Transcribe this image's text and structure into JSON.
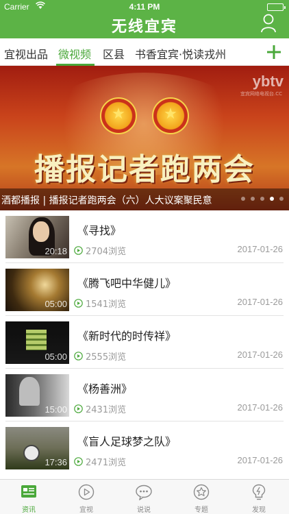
{
  "status_bar": {
    "carrier": "Carrier",
    "time": "4:11 PM"
  },
  "header": {
    "title": "无线宜宾",
    "user_icon": "user-icon"
  },
  "category_tabs": [
    {
      "label": "宜视出品",
      "active": false
    },
    {
      "label": "微视频",
      "active": true
    },
    {
      "label": "区县",
      "active": false
    },
    {
      "label": "书香宜宾·悦读戎州",
      "active": false
    }
  ],
  "add_tab_icon": "plus-icon",
  "banner": {
    "headline": "播报记者跑两会",
    "watermark": "ybtv",
    "watermark_sub": "宜宾网络电视台.CC",
    "caption": "酒都播报 | 播报记者跑两会（六）人大议案聚民意",
    "dots_total": 5,
    "dots_active_index": 3
  },
  "videos": [
    {
      "title": "《寻找》",
      "duration": "20:18",
      "views": "2704浏览",
      "date": "2017-01-26"
    },
    {
      "title": "《腾飞吧中华健儿》",
      "duration": "05:00",
      "views": "1541浏览",
      "date": "2017-01-26"
    },
    {
      "title": "《新时代的时传祥》",
      "duration": "05:00",
      "views": "2555浏览",
      "date": "2017-01-26"
    },
    {
      "title": "《杨善洲》",
      "duration": "15:00",
      "views": "2431浏览",
      "date": "2017-01-26"
    },
    {
      "title": "《盲人足球梦之队》",
      "duration": "17:36",
      "views": "2471浏览",
      "date": "2017-01-26"
    }
  ],
  "bottom_tabs": [
    {
      "label": "资讯",
      "icon": "news-icon",
      "active": true
    },
    {
      "label": "宜视",
      "icon": "play-circle-icon",
      "active": false
    },
    {
      "label": "说说",
      "icon": "chat-bubble-icon",
      "active": false
    },
    {
      "label": "专题",
      "icon": "star-icon",
      "active": false
    },
    {
      "label": "发现",
      "icon": "discover-icon",
      "active": false
    }
  ],
  "colors": {
    "brand_green": "#5cb346",
    "active_green": "#4aa83a",
    "meta_gray": "#9a9a9a"
  }
}
